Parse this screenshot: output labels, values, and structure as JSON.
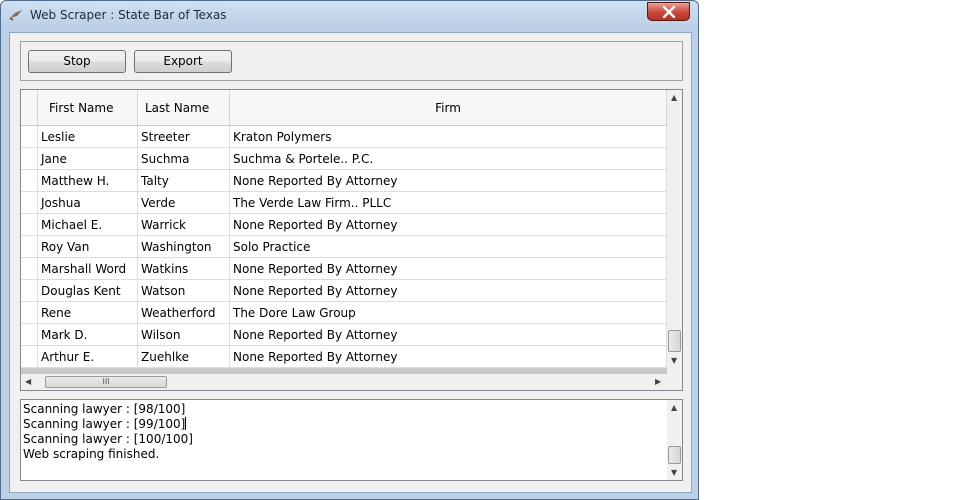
{
  "window": {
    "title": "Web Scraper : State Bar of Texas"
  },
  "toolbar": {
    "stop_label": "Stop",
    "export_label": "Export"
  },
  "grid": {
    "columns": [
      "First Name",
      "Last Name",
      "Firm"
    ],
    "rows": [
      [
        "Leslie",
        "Streeter",
        "Kraton Polymers"
      ],
      [
        "Jane",
        "Suchma",
        "Suchma & Portele.. P.C."
      ],
      [
        "Matthew H.",
        "Talty",
        "None Reported By Attorney"
      ],
      [
        "Joshua",
        "Verde",
        "The Verde Law Firm.. PLLC"
      ],
      [
        "Michael E.",
        "Warrick",
        "None Reported By Attorney"
      ],
      [
        "Roy Van",
        "Washington",
        "Solo Practice"
      ],
      [
        "Marshall Word",
        "Watkins",
        "None Reported By Attorney"
      ],
      [
        "Douglas Kent",
        "Watson",
        "None Reported By Attorney"
      ],
      [
        "Rene",
        "Weatherford",
        "The Dore Law Group"
      ],
      [
        "Mark D.",
        "Wilson",
        "None Reported By Attorney"
      ],
      [
        "Arthur E.",
        "Zuehlke",
        "None Reported By Attorney"
      ]
    ]
  },
  "log": {
    "lines": [
      "Scanning lawyer : [98/100]",
      "Scanning lawyer : [99/100]",
      "Scanning lawyer : [100/100]",
      "Web scraping finished."
    ]
  },
  "scrollbar": {
    "thumb_grip": "III"
  }
}
